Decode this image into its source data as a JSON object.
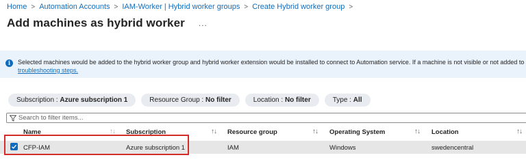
{
  "breadcrumb": {
    "items": [
      "Home",
      "Automation Accounts",
      "IAM-Worker | Hybrid worker groups",
      "Create Hybrid worker group"
    ],
    "separator": ">"
  },
  "page": {
    "title": "Add machines as hybrid worker",
    "more_label": "..."
  },
  "info": {
    "message": "Selected machines would be added to the hybrid worker group and hybrid worker extension would be installed to connect to Automation service. If a machine is not visible or not added to the group",
    "link_text": "troubleshooting steps."
  },
  "filters": [
    {
      "label": "Subscription :",
      "value": "Azure subscription 1"
    },
    {
      "label": "Resource Group :",
      "value": "No filter"
    },
    {
      "label": "Location :",
      "value": "No filter"
    },
    {
      "label": "Type :",
      "value": "All"
    }
  ],
  "search": {
    "placeholder": "Search to filter items..."
  },
  "table": {
    "columns": [
      "Name",
      "Subscription",
      "Resource group",
      "Operating System",
      "Location"
    ],
    "sort_glyph": "↑↓",
    "rows": [
      {
        "name": "CFP-IAM",
        "subscription": "Azure subscription 1",
        "resource_group": "IAM",
        "os": "Windows",
        "location": "swedencentral",
        "selected": true
      }
    ]
  },
  "colors": {
    "accent": "#0f6cbd",
    "highlight": "#d62b2b",
    "banner_bg": "#eaf2fb",
    "pill_bg": "#e8ebf0"
  }
}
